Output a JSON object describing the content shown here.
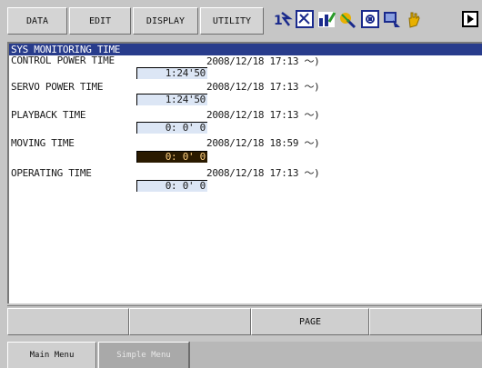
{
  "top_menu": {
    "tabs": [
      {
        "label": "DATA"
      },
      {
        "label": "EDIT"
      },
      {
        "label": "DISPLAY"
      },
      {
        "label": "UTILITY"
      }
    ],
    "status_icons": [
      "coordinate-icon",
      "edit-icon",
      "chart-icon",
      "tool-icon",
      "frame-icon",
      "servo-icon",
      "hand-icon",
      "page-arrow-icon"
    ]
  },
  "panel": {
    "title": "SYS MONITORING TIME",
    "rows": [
      {
        "label": "CONTROL POWER TIME",
        "date": "2008/12/18 17:13 ～)",
        "value": "1:24'50",
        "selected": false
      },
      {
        "label": "SERVO POWER TIME",
        "date": "2008/12/18 17:13 ～)",
        "value": "1:24'50",
        "selected": false
      },
      {
        "label": "PLAYBACK TIME",
        "date": "2008/12/18 17:13 ～)",
        "value": "0: 0' 0",
        "selected": false
      },
      {
        "label": "MOVING TIME",
        "date": "2008/12/18 18:59 ～)",
        "value": "0: 0' 0",
        "selected": true
      },
      {
        "label": "OPERATING TIME",
        "date": "2008/12/18 17:13 ～)",
        "value": "0: 0' 0",
        "selected": false
      }
    ]
  },
  "function_keys": [
    "",
    "",
    "PAGE",
    ""
  ],
  "bottom_menu": {
    "main_label": "Main Menu",
    "simple_label": "Simple Menu"
  },
  "colors": {
    "title_bar": "#283c8c",
    "value_box": "#dce6f5",
    "selected_value": "#2a1a00"
  }
}
